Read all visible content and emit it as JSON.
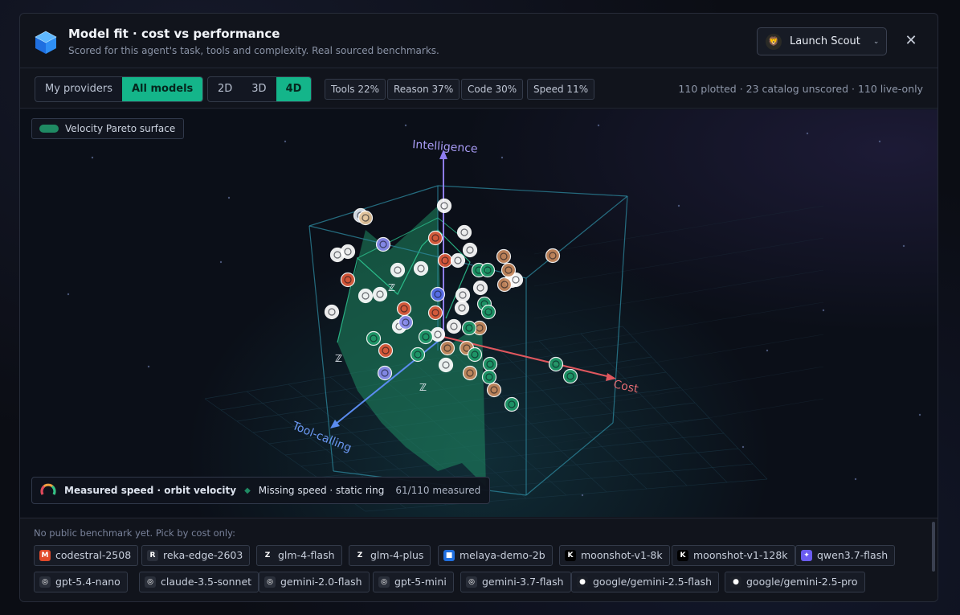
{
  "header": {
    "title": "Model fit · cost vs performance",
    "subtitle": "Scored for this agent's task, tools and complexity. Real sourced benchmarks.",
    "launch_label": "Launch Scout",
    "logo_icon": "cube-logo-icon",
    "close_icon": "close-icon"
  },
  "toolbar": {
    "provider_scope": [
      "My providers",
      "All models"
    ],
    "provider_scope_selected": "All models",
    "dimensions": [
      "2D",
      "3D",
      "4D"
    ],
    "dimension_selected": "4D",
    "weights": [
      "Tools 22%",
      "Reason 37%",
      "Code 30%",
      "Speed 11%"
    ],
    "summary": "110 plotted · 23 catalog unscored · 110 live-only"
  },
  "plot": {
    "surface_legend": "Velocity Pareto surface",
    "axis_intelligence": "Intelligence",
    "axis_cost": "Cost",
    "axis_tool": "Tool-calling",
    "speed_measured": "Measured speed · orbit velocity",
    "speed_missing": "Missing speed · static ring",
    "speed_count": "61/110 measured",
    "colors": {
      "surface": "#1f8a63",
      "cost_axis": "#e0575e",
      "intel_axis": "#8d7cf0",
      "tool_axis": "#5b8cf0",
      "box": "#2d8aa0"
    }
  },
  "footer": {
    "note": "No public benchmark yet. Pick by cost only:",
    "unscored_models": [
      {
        "name": "codestral-2508",
        "icon": "mistral-icon"
      },
      {
        "name": "reka-edge-2603",
        "icon": "reka-icon"
      },
      {
        "name": "glm-4-flash",
        "icon": "zhipu-icon"
      },
      {
        "name": "glm-4-plus",
        "icon": "zhipu-icon"
      },
      {
        "name": "melaya-demo-2b",
        "icon": "cube-icon"
      },
      {
        "name": "moonshot-v1-8k",
        "icon": "moonshot-icon"
      },
      {
        "name": "moonshot-v1-128k",
        "icon": "moonshot-icon"
      },
      {
        "name": "qwen3.7-flash",
        "icon": "qwen-icon"
      },
      {
        "name": "gpt-5.4-nano",
        "icon": "openai-icon"
      },
      {
        "name": "claude-3.5-sonnet",
        "icon": "openai-icon"
      },
      {
        "name": "gemini-2.0-flash",
        "icon": "openai-icon"
      },
      {
        "name": "gpt-5-mini",
        "icon": "openai-icon"
      },
      {
        "name": "gemini-3.7-flash",
        "icon": "openai-icon"
      },
      {
        "name": "google/gemini-2.5-flash",
        "icon": "google-icon"
      },
      {
        "name": "google/gemini-2.5-pro",
        "icon": "google-icon"
      }
    ]
  }
}
